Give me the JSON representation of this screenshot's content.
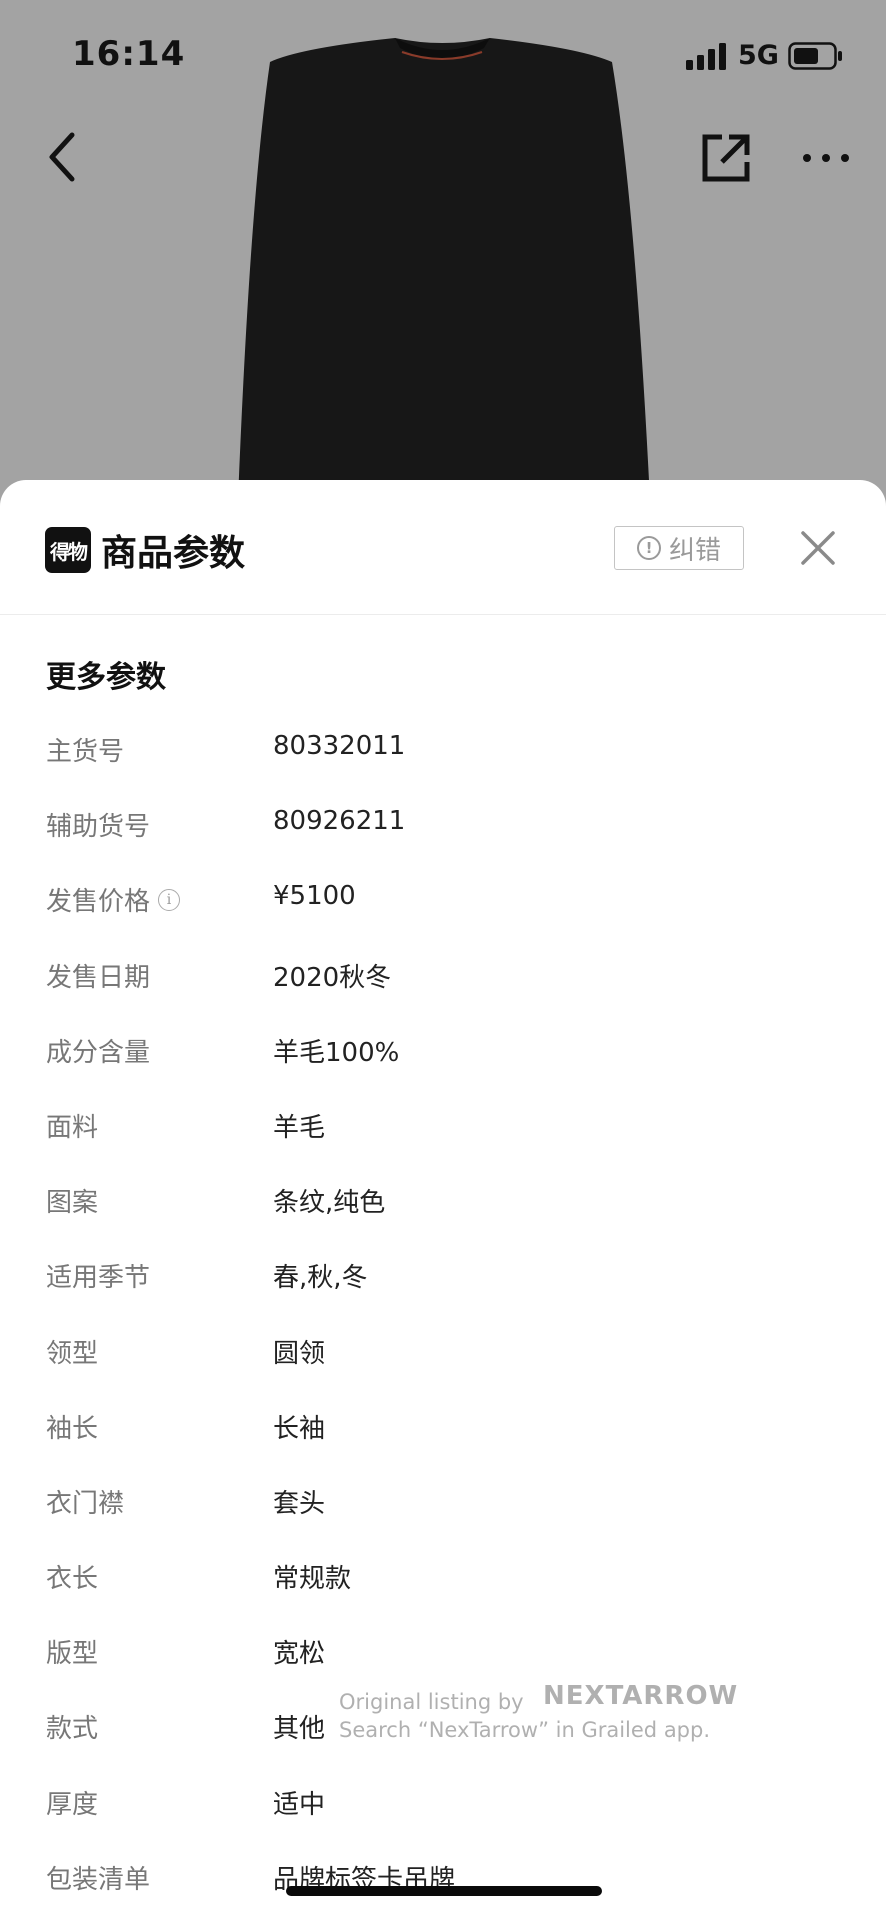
{
  "status_bar": {
    "time": "16:14",
    "network": "5G"
  },
  "nav": {
    "back_icon": "chevron-left-icon",
    "share_icon": "share-icon",
    "more_icon": "more-icon"
  },
  "sheet": {
    "logo_text": "得物",
    "title": "商品参数",
    "correct_label": "纠错",
    "section_title": "更多参数",
    "params": [
      {
        "label": "主货号",
        "value": "80332011"
      },
      {
        "label": "辅助货号",
        "value": "80926211"
      },
      {
        "label": "发售价格",
        "value": "¥5100"
      },
      {
        "label": "发售日期",
        "value": "2020秋冬"
      },
      {
        "label": "成分含量",
        "value": "羊毛100%"
      },
      {
        "label": "面料",
        "value": "羊毛"
      },
      {
        "label": "图案",
        "value": "条纹,纯色"
      },
      {
        "label": "适用季节",
        "value": "春,秋,冬"
      },
      {
        "label": "领型",
        "value": "圆领"
      },
      {
        "label": "袖长",
        "value": "长袖"
      },
      {
        "label": "衣门襟",
        "value": "套头"
      },
      {
        "label": "衣长",
        "value": "常规款"
      },
      {
        "label": "版型",
        "value": "宽松"
      },
      {
        "label": "款式",
        "value": "其他"
      },
      {
        "label": "厚度",
        "value": "适中"
      },
      {
        "label": "包装清单",
        "value": "品牌标签卡吊牌"
      }
    ]
  },
  "watermark": {
    "line1": "Original listing by",
    "brand": "NEXTARROW",
    "line2": "Search “NexTarrow” in Grailed app."
  },
  "colors": {
    "sheet_bg": "#ffffff",
    "hero_bg": "#a3a3a3",
    "label": "#777777",
    "value": "#222222"
  }
}
